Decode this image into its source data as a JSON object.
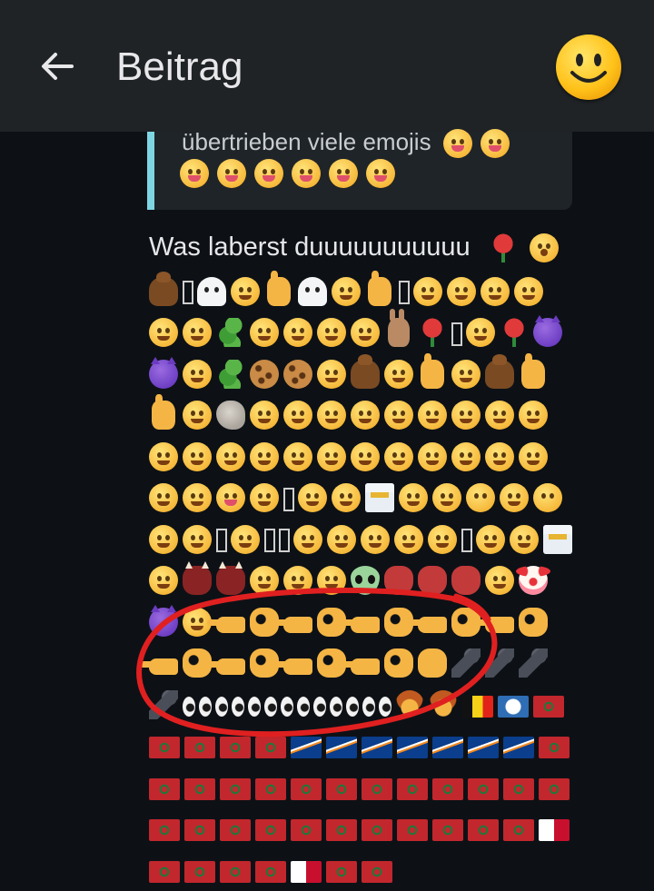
{
  "header": {
    "title": "Beitrag",
    "back_icon": "arrow-left-icon",
    "avatar_icon": "smiley-face-avatar"
  },
  "quote": {
    "text": "übertrieben viele emojis",
    "accent_color": "#7fd6e3"
  },
  "post": {
    "text": "Was laberst duuuuuuuuuuu"
  },
  "colors": {
    "background": "#0d1116",
    "topbar": "#1f2326",
    "annotation_circle": "#e02020"
  }
}
